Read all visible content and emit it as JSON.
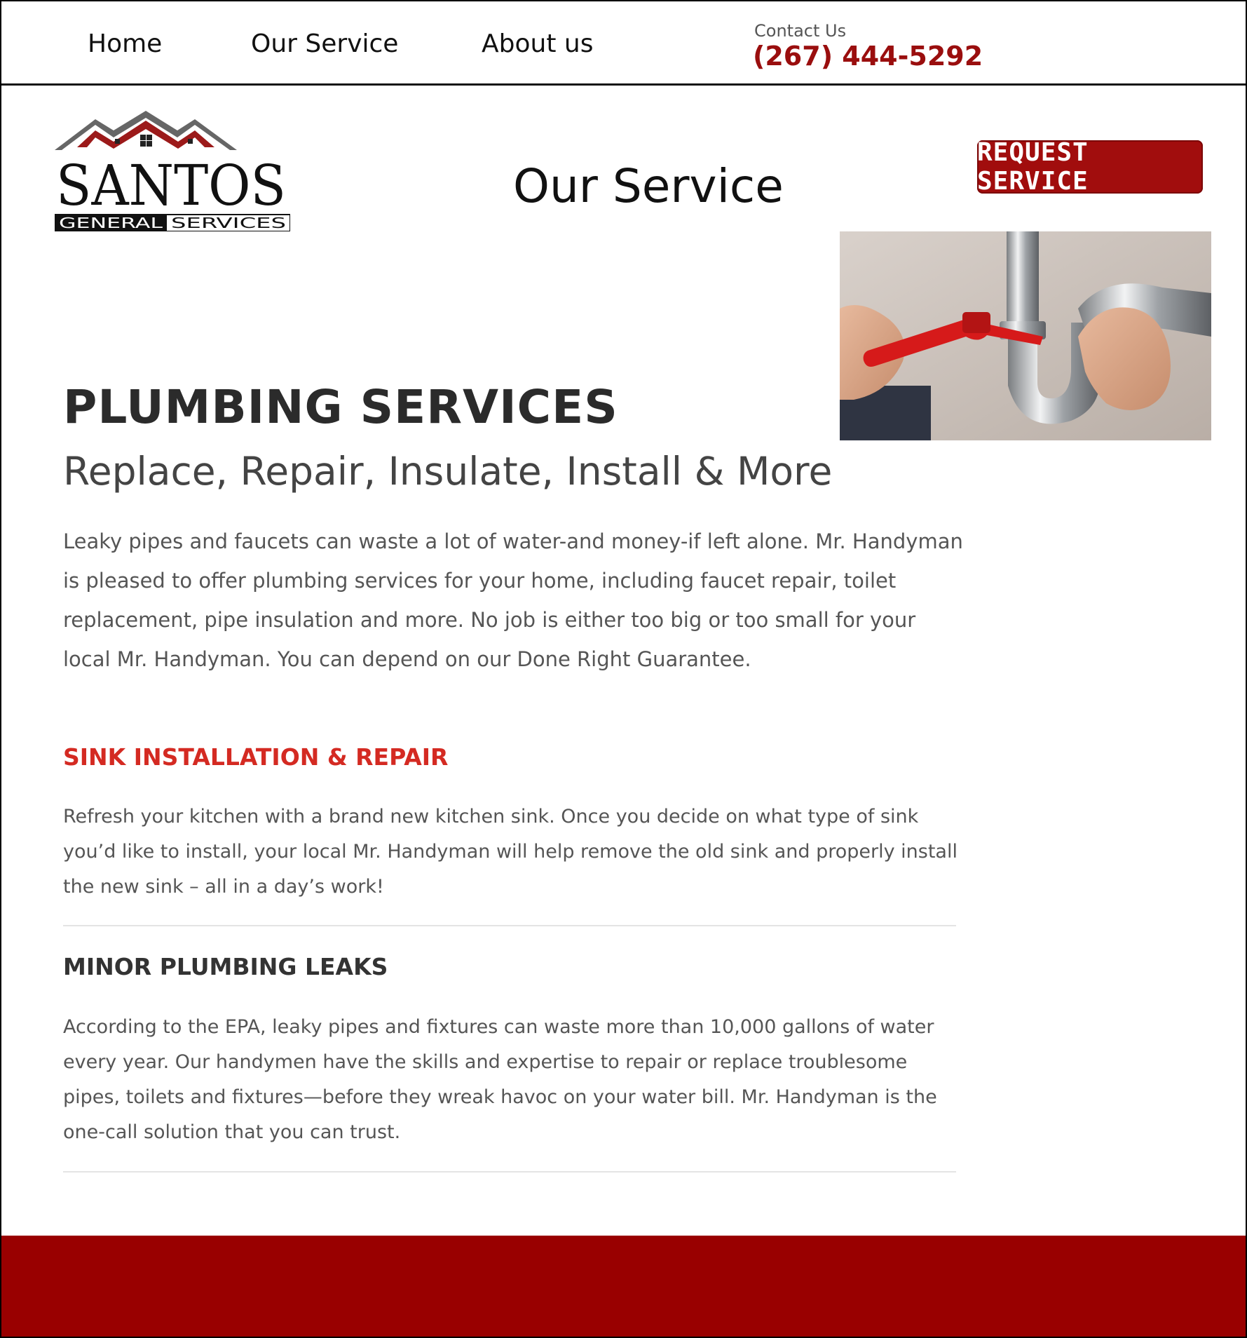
{
  "nav": {
    "links": [
      "Home",
      "Our Service",
      "About us"
    ],
    "contact_label": "Contact Us",
    "contact_phone": "(267) 444-5292"
  },
  "logo": {
    "name": "SANTOS",
    "tagline_left": "GENERAL",
    "tagline_right": "SERVICES"
  },
  "page": {
    "heading": "Our Service",
    "request_button": "REQUEST SERVICE"
  },
  "content": {
    "title": "PLUMBING SERVICES",
    "subtitle": "Replace, Repair, Insulate, Install & More",
    "intro": "Leaky pipes and faucets can waste a lot of water-and money-if left alone. Mr. Handyman is pleased to offer plumbing services for your home, including faucet repair, toilet replacement, pipe insulation and more. No job is either too big or too small for your local Mr. Handyman. You can depend on our Done Right Guarantee.",
    "sections": [
      {
        "heading": "SINK INSTALLATION & REPAIR",
        "body": "Refresh your kitchen with a brand new kitchen sink. Once you decide on what type of sink you’d like to install, your local Mr. Handyman will help remove the old sink and properly install the new sink – all in a day’s work!"
      },
      {
        "heading": "MINOR PLUMBING LEAKS",
        "body": "According to the EPA, leaky pipes and fixtures can waste more than 10,000 gallons of water every year. Our handymen have the skills and expertise to repair or replace troublesome pipes, toilets and fixtures—before they wreak havoc on your water bill. Mr. Handyman is the one-call solution that you can trust."
      }
    ]
  },
  "colors": {
    "brand_red": "#990000",
    "phone_red": "#9a0e0e",
    "section_red": "#d42a22"
  }
}
